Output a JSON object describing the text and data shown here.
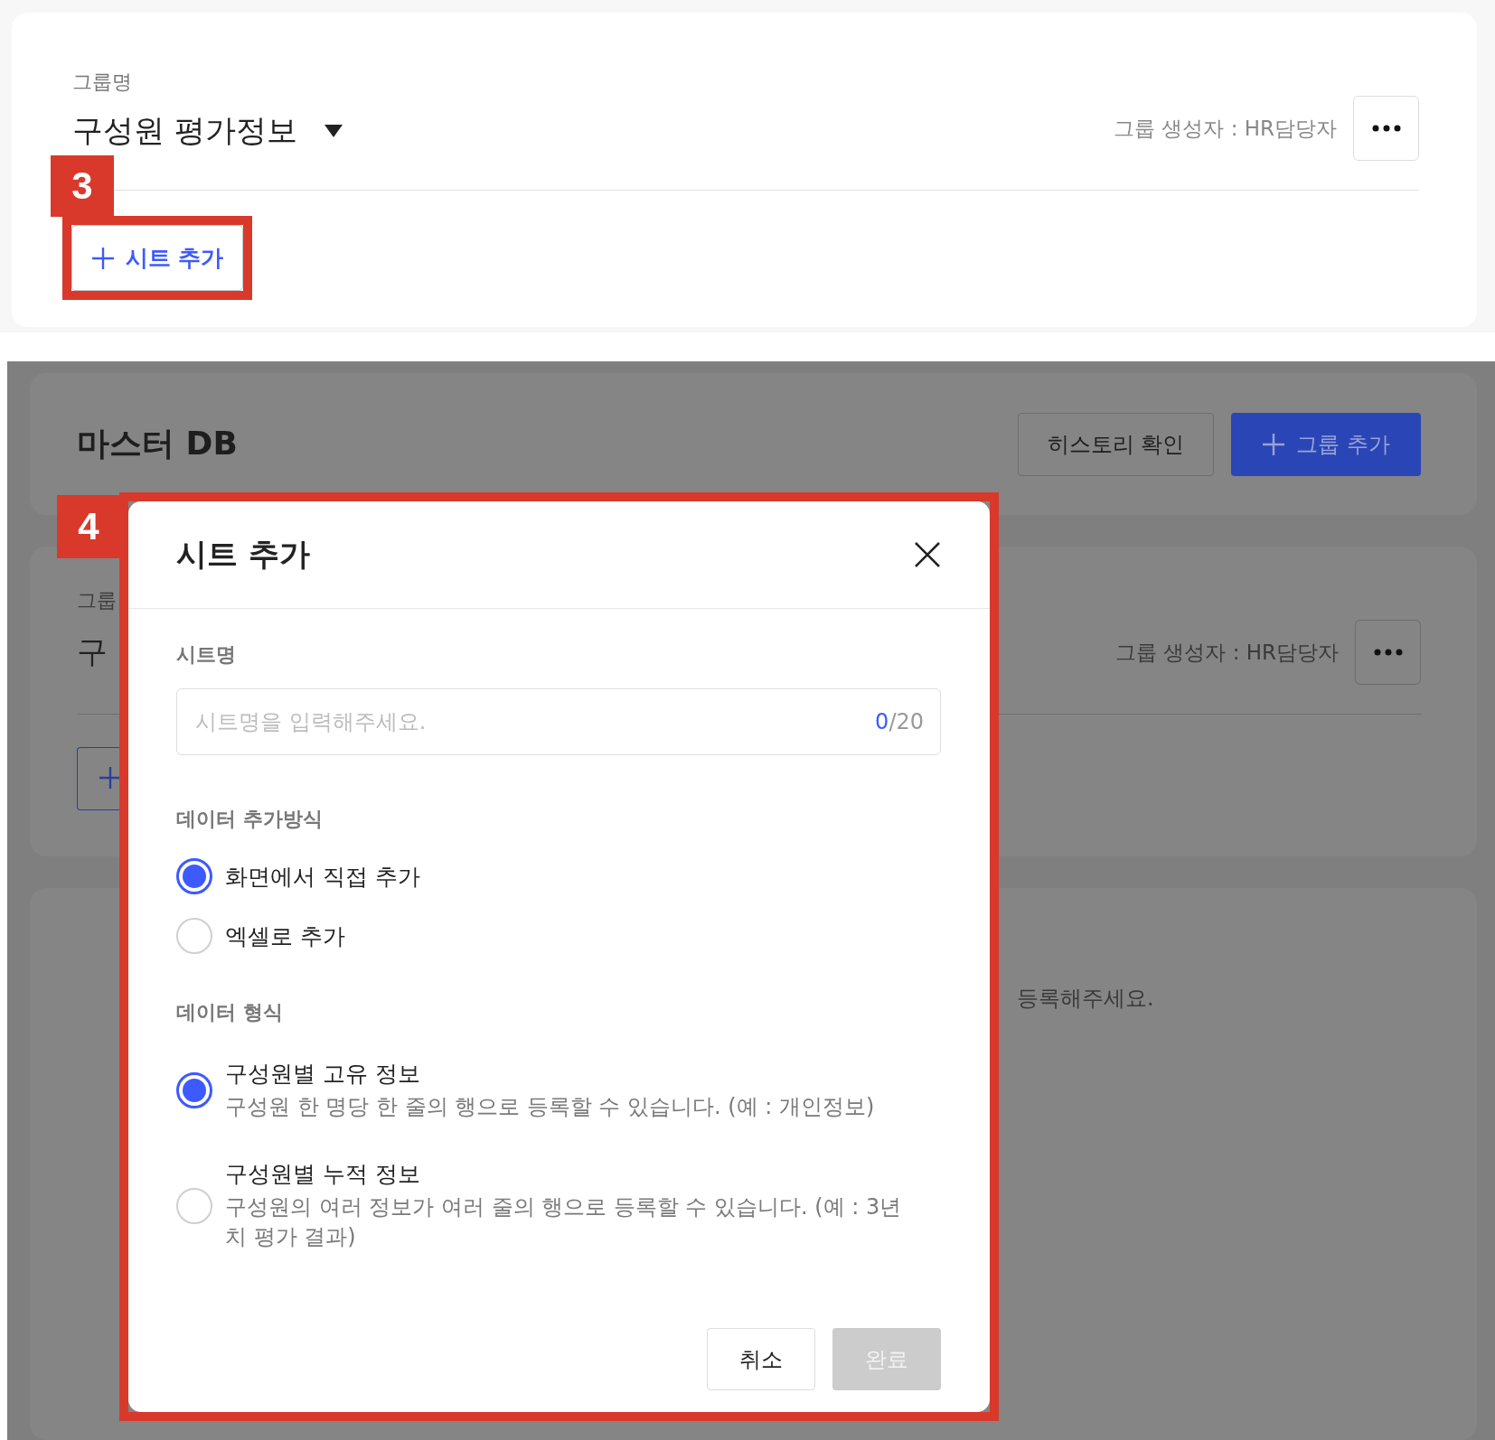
{
  "step3": {
    "badge": "3",
    "group_label": "그룹명",
    "group_name": "구성원 평가정보",
    "creator": "그룹 생성자 : HR담당자",
    "add_sheet_button": "시트 추가"
  },
  "step4": {
    "badge": "4",
    "page_title": "마스터 DB",
    "history_button": "히스토리 확인",
    "add_group_button": "그룹 추가",
    "group_label_partial": "그룹",
    "group_name_partial": "구",
    "creator": "그룹 생성자 : HR담당자",
    "empty_hint_partial": "등록해주세요.",
    "modal": {
      "title": "시트 추가",
      "sheet_name": {
        "label": "시트명",
        "placeholder": "시트명을 입력해주세요.",
        "count": "0",
        "limit": "/20"
      },
      "sections": [
        {
          "label": "데이터 추가방식",
          "options": [
            {
              "label": "화면에서 직접 추가",
              "selected": true
            },
            {
              "label": "엑셀로 추가",
              "selected": false
            }
          ]
        },
        {
          "label": "데이터 형식",
          "options": [
            {
              "label": "구성원별 고유 정보",
              "description": "구성원 한 명당 한 줄의 행으로 등록할 수 있습니다. (예 : 개인정보)",
              "selected": true
            },
            {
              "label": "구성원별 누적 정보",
              "description": "구성원의 여러 정보가 여러 줄의 행으로 등록할 수 있습니다. (예 : 3년치 평가 결과)",
              "selected": false
            }
          ]
        }
      ],
      "buttons": [
        {
          "label": "취소",
          "kind": "cancel",
          "disabled": false
        },
        {
          "label": "완료",
          "kind": "confirm",
          "disabled": true
        }
      ]
    }
  }
}
